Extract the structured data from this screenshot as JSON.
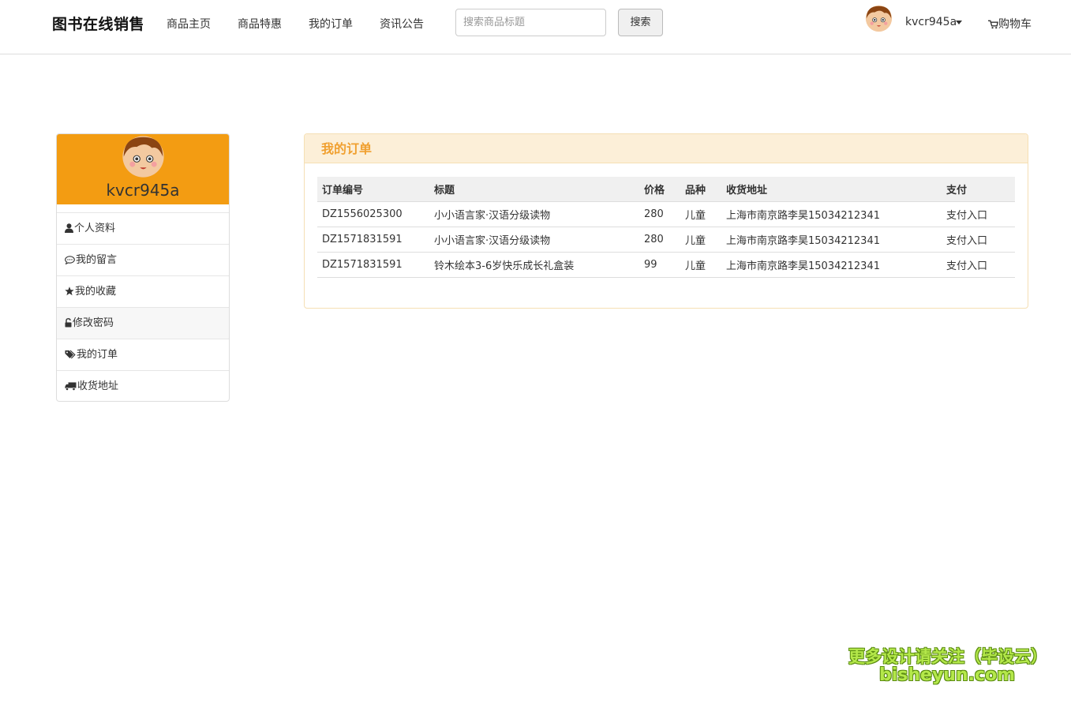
{
  "nav": {
    "brand": "图书在线销售",
    "links": [
      "商品主页",
      "商品特惠",
      "我的订单",
      "资讯公告"
    ],
    "search_placeholder": "搜索商品标题",
    "search_button": "搜索",
    "username": "kvcr945a",
    "cart_label": "购物车",
    "cart_icon": "cart-icon",
    "avatar_icon": "avatar-icon"
  },
  "sidebar": {
    "username": "kvcr945a",
    "header_color": "#f39c12",
    "items": [
      {
        "label": "个人资料",
        "icon": "user-icon"
      },
      {
        "label": "我的留言",
        "icon": "comment-icon"
      },
      {
        "label": "我的收藏",
        "icon": "star-icon"
      },
      {
        "label": "修改密码",
        "icon": "unlock-icon"
      },
      {
        "label": "我的订单",
        "icon": "tags-icon"
      },
      {
        "label": "收货地址",
        "icon": "truck-icon"
      }
    ]
  },
  "orders": {
    "title": "我的订单",
    "accent_color": "#f0a030",
    "columns": [
      "订单编号",
      "标题",
      "价格",
      "品种",
      "收货地址",
      "支付"
    ],
    "rows": [
      {
        "id": "DZ1556025300",
        "title": "小小语言家·汉语分级读物",
        "price": "280",
        "category": "儿童",
        "address": "上海市南京路李昊15034212341",
        "pay": "支付入口"
      },
      {
        "id": "DZ1571831591",
        "title": "小小语言家·汉语分级读物",
        "price": "280",
        "category": "儿童",
        "address": "上海市南京路李昊15034212341",
        "pay": "支付入口"
      },
      {
        "id": "DZ1571831591",
        "title": "铃木绘本3-6岁快乐成长礼盒装",
        "price": "99",
        "category": "儿童",
        "address": "上海市南京路李昊15034212341",
        "pay": "支付入口"
      }
    ]
  },
  "watermark": {
    "line1": "更多设计请关注（毕设云）",
    "line2": "bisheyun.com"
  }
}
